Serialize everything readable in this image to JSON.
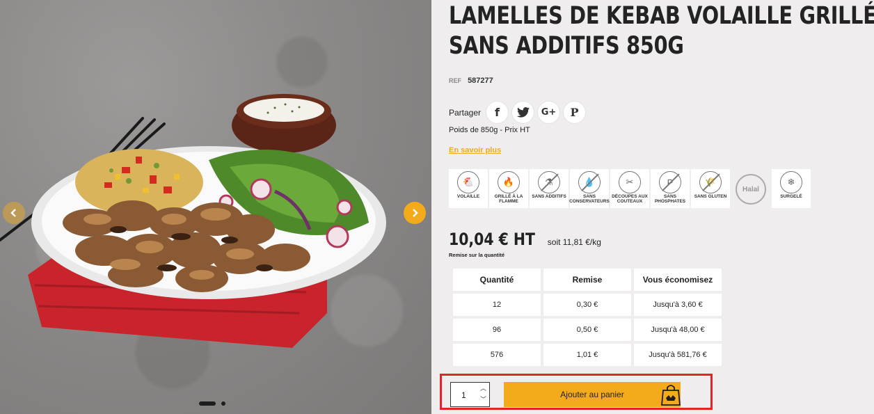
{
  "product": {
    "title_line1": "LAMELLES DE KEBAB VOLAILLE GRILLÉES",
    "title_line2": "SANS ADDITIFS 850G",
    "ref_label": "REF",
    "ref_value": "587277",
    "share_label": "Partager",
    "share_buttons": [
      {
        "icon": "facebook-icon",
        "glyph": "f"
      },
      {
        "icon": "twitter-icon",
        "glyph": "🐦"
      },
      {
        "icon": "google-plus-icon",
        "glyph": "G+"
      },
      {
        "icon": "pinterest-icon",
        "glyph": "P"
      }
    ],
    "weight_text": "Poids de 850g - Prix HT",
    "more_link": "En savoir plus"
  },
  "badges": [
    {
      "icon": "chicken-icon",
      "glyph": "🐔",
      "label": "VOLAILLE",
      "barred": false
    },
    {
      "icon": "flame-icon",
      "glyph": "🔥",
      "label": "GRILLÉ À LA FLAMME",
      "barred": false
    },
    {
      "icon": "no-additives-icon",
      "glyph": "⚗",
      "label": "SANS ADDITIFS",
      "barred": true
    },
    {
      "icon": "no-preservatives-icon",
      "glyph": "💧",
      "label": "SANS CONSERVATEURS",
      "barred": true
    },
    {
      "icon": "knife-cut-icon",
      "glyph": "✂",
      "label": "DÉCOUPES AUX COUTEAUX",
      "barred": false
    },
    {
      "icon": "no-phosphates-icon",
      "glyph": "P",
      "label": "SANS PHOSPHATES",
      "barred": true
    },
    {
      "icon": "gluten-free-icon",
      "glyph": "🌾",
      "label": "SANS GLUTEN",
      "barred": true
    },
    {
      "icon": "halal-icon",
      "glyph": "Halal",
      "label": "",
      "barred": false,
      "halal": true
    },
    {
      "icon": "frozen-icon",
      "glyph": "❄",
      "label": "SURGELÉ",
      "barred": false
    }
  ],
  "pricing": {
    "price": "10,04 € HT",
    "per_kg": "soit 11,81 €/kg",
    "remise_label": "Remise sur la quantité",
    "headers": [
      "Quantité",
      "Remise",
      "Vous économisez"
    ],
    "rows": [
      [
        "12",
        "0,30 €",
        "Jusqu'à 3,60 €"
      ],
      [
        "96",
        "0,50 €",
        "Jusqu'à 48,00 €"
      ],
      [
        "576",
        "1,01 €",
        "Jusqu'à 581,76 €"
      ]
    ]
  },
  "cart": {
    "quantity": "1",
    "add_label": "Ajouter au panier"
  },
  "gallery": {
    "slide_count": 2,
    "active_slide": 1
  },
  "colors": {
    "accent": "#f3aa1b",
    "highlight_border": "#e2232a",
    "background": "#efedee"
  }
}
